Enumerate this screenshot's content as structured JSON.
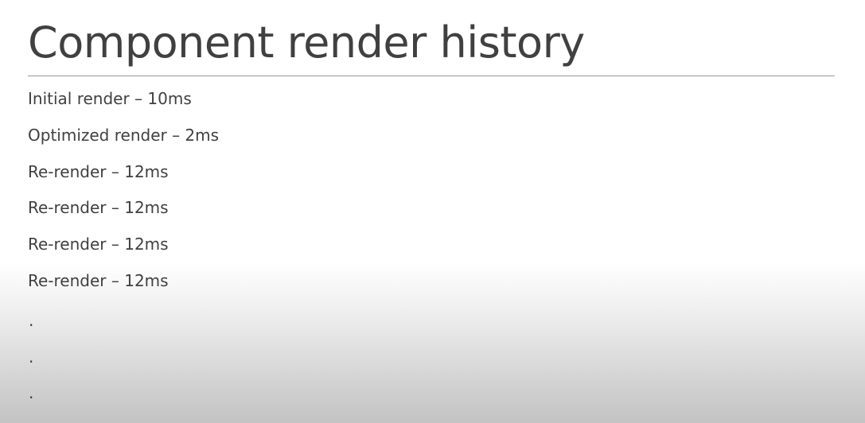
{
  "slide": {
    "title": "Component render history",
    "items": [
      "Initial render – 10ms",
      "Optimized render – 2ms",
      "Re-render – 12ms",
      "Re-render – 12ms",
      "Re-render – 12ms",
      "Re-render – 12ms"
    ],
    "ellipsis": [
      ".",
      ".",
      "."
    ]
  }
}
